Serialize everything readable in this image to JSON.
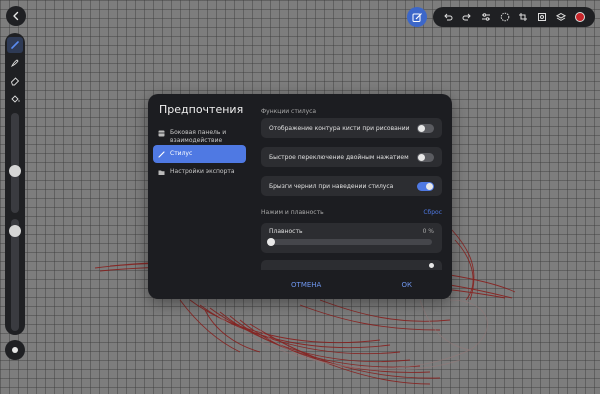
{
  "dialog": {
    "title": "Предпочтения",
    "nav": [
      {
        "label": "Боковая панель и взаимодействие",
        "icon": "sidebar-panel-icon"
      },
      {
        "label": "Стилус",
        "icon": "stylus-pen-icon",
        "active": true
      },
      {
        "label": "Настройки экспорта",
        "icon": "folder-export-icon"
      }
    ],
    "section_stylus": "Функции стилуса",
    "options": [
      {
        "label": "Отображение контура кисти при рисовании",
        "on": false
      },
      {
        "label": "Быстрое переключение двойным нажатием",
        "on": false
      },
      {
        "label": "Брызги чернил при наведении стилуса",
        "on": true
      }
    ],
    "section_pressure": "Нажим и плавность",
    "reset_label": "Сброс",
    "smoothness": {
      "label": "Плавность",
      "value_text": "0 %",
      "value": 0
    },
    "cancel_label": "ОТМЕНА",
    "ok_label": "ОК"
  },
  "colors": {
    "accent": "#4f79e3",
    "panel": "#1c1d21",
    "card": "#2c2d31",
    "current_brush_color": "#c8262b"
  }
}
